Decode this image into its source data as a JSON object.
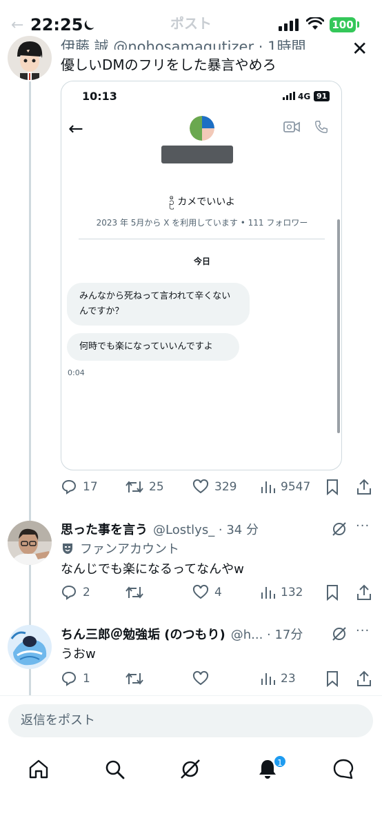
{
  "status_bar": {
    "time": "22:25",
    "battery": "100"
  },
  "header": {
    "title": "ポスト"
  },
  "post": {
    "author_cut": "伊藤 誠 @nohosamagutizer · 1時間",
    "text": "優しいDMのフリをした暴言やめろ",
    "embed": {
      "time": "10:13",
      "network": "4G",
      "battery": "91",
      "name": "ဦ  カメでいいよ",
      "meta": "2023 年 5月から X を利用しています • 111 フォロワー",
      "date_divider": "今日",
      "messages": [
        {
          "text": "みんなから死ねって言われて辛くないんですか？"
        },
        {
          "text": "何時でも楽になっていいんですよ"
        }
      ],
      "timestamp": "0:04"
    },
    "actions": {
      "replies": "17",
      "reposts": "25",
      "likes": "329",
      "views": "9547"
    }
  },
  "replies": [
    {
      "name": "思った事を言う",
      "handle": "@Lostlys_ · 34 分",
      "fan_label": "ファンアカウント",
      "text": "なんじでも楽になるってなんやw",
      "actions": {
        "replies": "2",
        "reposts": "",
        "likes": "4",
        "views": "132"
      }
    },
    {
      "name": "ちん三郎＠勉強垢 (のつもり)",
      "handle": "@h... · 17分",
      "text": "うおw",
      "actions": {
        "replies": "1",
        "reposts": "",
        "likes": "",
        "views": "23"
      }
    }
  ],
  "composer": {
    "placeholder": "返信をポスト"
  },
  "tab_bar": {
    "notification_count": "1"
  },
  "colors": {
    "accent": "#1d9bf0",
    "battery": "#34c759",
    "muted": "#536471"
  }
}
